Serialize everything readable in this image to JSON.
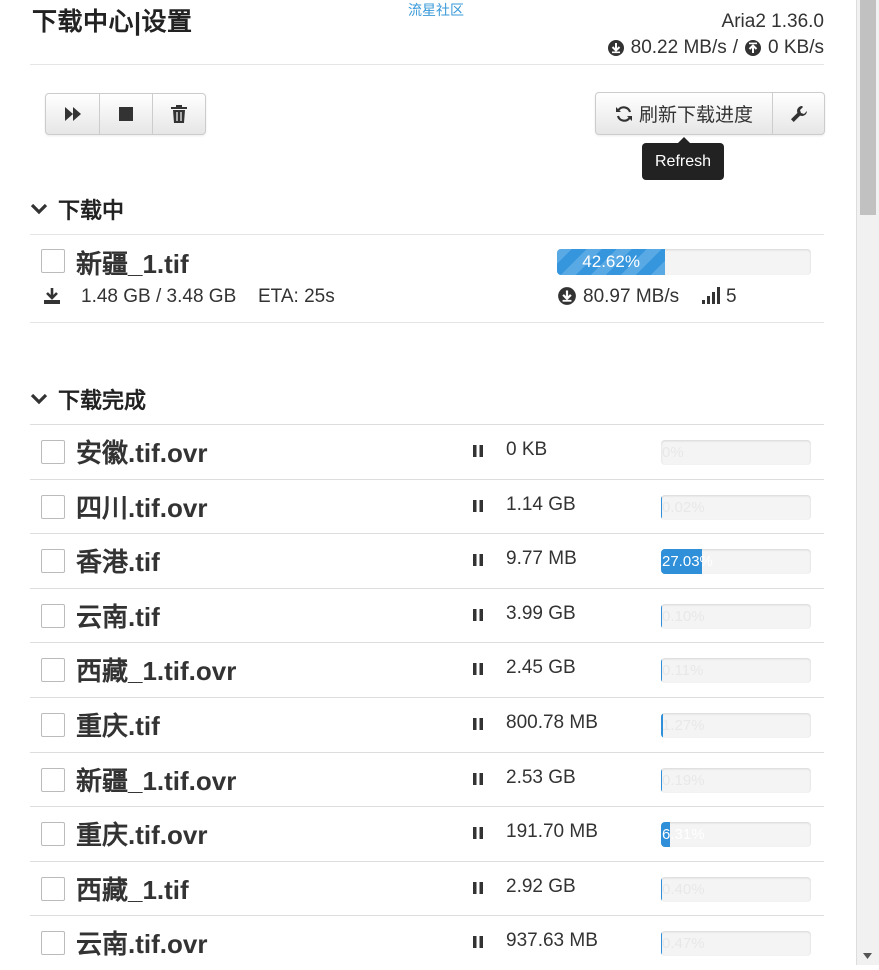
{
  "header": {
    "title": "下载中心|设置",
    "community_link": "流星社区",
    "version": "Aria2 1.36.0",
    "download_speed": "80.22 MB/s",
    "speed_separator": "/",
    "upload_speed": "0 KB/s"
  },
  "toolbar": {
    "refresh_label": "刷新下载进度",
    "tooltip": "Refresh"
  },
  "downloading": {
    "heading": "下载中",
    "item": {
      "name": "新疆_1.tif",
      "progress_text": "1.48 GB / 3.48 GB",
      "eta": "ETA: 25s",
      "percent_label": "42.62%",
      "percent": 42.62,
      "speed": "80.97 MB/s",
      "connections": "5"
    }
  },
  "completed": {
    "heading": "下载完成",
    "items": [
      {
        "name": "安徽.tif.ovr",
        "size": "0 KB",
        "percent_label": "0%",
        "percent": 0
      },
      {
        "name": "四川.tif.ovr",
        "size": "1.14 GB",
        "percent_label": "0.02%",
        "percent": 0.02
      },
      {
        "name": "香港.tif",
        "size": "9.77 MB",
        "percent_label": "27.03%",
        "percent": 27.03
      },
      {
        "name": "云南.tif",
        "size": "3.99 GB",
        "percent_label": "0.10%",
        "percent": 0.1
      },
      {
        "name": "西藏_1.tif.ovr",
        "size": "2.45 GB",
        "percent_label": "0.11%",
        "percent": 0.11
      },
      {
        "name": "重庆.tif",
        "size": "800.78 MB",
        "percent_label": "1.27%",
        "percent": 1.27
      },
      {
        "name": "新疆_1.tif.ovr",
        "size": "2.53 GB",
        "percent_label": "0.19%",
        "percent": 0.19
      },
      {
        "name": "重庆.tif.ovr",
        "size": "191.70 MB",
        "percent_label": "6.31%",
        "percent": 6.31
      },
      {
        "name": "西藏_1.tif",
        "size": "2.92 GB",
        "percent_label": "0.40%",
        "percent": 0.4
      },
      {
        "name": "云南.tif.ovr",
        "size": "937.63 MB",
        "percent_label": "0.47%",
        "percent": 0.47
      }
    ]
  },
  "colors": {
    "accent": "#2f8fd9",
    "tooltip_bg": "#222222"
  },
  "icons": [
    "fast-forward-icon",
    "stop-icon",
    "trash-icon",
    "refresh-icon",
    "wrench-icon",
    "chevron-down-icon",
    "download-icon",
    "speed-icon",
    "signal-icon",
    "pause-icon"
  ]
}
